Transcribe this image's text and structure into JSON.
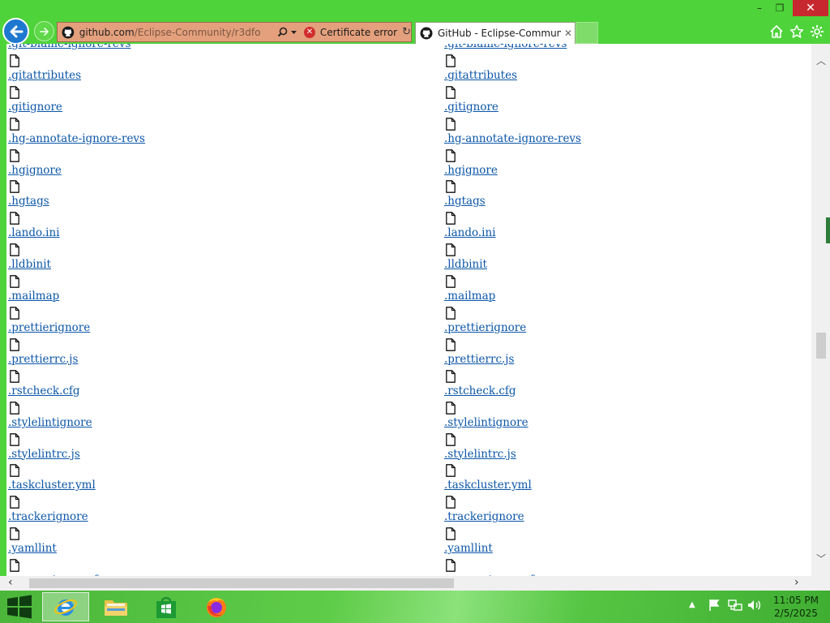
{
  "browser": {
    "address": {
      "domain": "github.com",
      "path": "/Eclipse-Community/r3dfo",
      "certificate_label": "Certificate error"
    },
    "tab": {
      "title": "GitHub - Eclipse-Communi...",
      "close_glyph": "✕"
    },
    "window_controls": {
      "minimize": "–",
      "restore": "❐",
      "close": "✕"
    }
  },
  "file_list": {
    "top_partial": ".git-blame-ignore-revs",
    "items": [
      ".gitattributes",
      ".gitignore",
      ".hg-annotate-ignore-revs",
      ".hgignore",
      ".hgtags",
      ".lando.ini",
      ".lldbinit",
      ".mailmap",
      ".prettierignore",
      ".prettierrc.js",
      ".rstcheck.cfg",
      ".stylelintignore",
      ".stylelintrc.js",
      ".taskcluster.yml",
      ".trackerignore",
      ".yamllint"
    ],
    "bottom_partial": ".ycm_extra_conf"
  },
  "taskbar": {
    "clock_time": "11:05 PM",
    "clock_date": "2/5/2025"
  },
  "colors": {
    "chrome_green": "#4ed33a",
    "link_blue": "#0b56a8",
    "close_red": "#c7282f",
    "address_bar_cert_error": "#e4a07c"
  }
}
